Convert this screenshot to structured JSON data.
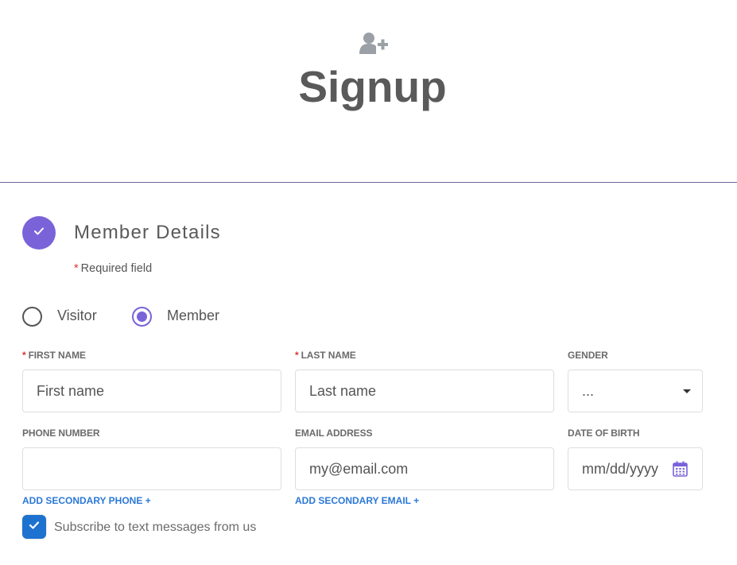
{
  "header": {
    "icon": "add-user-icon",
    "title": "Signup"
  },
  "section": {
    "step_icon": "check-icon",
    "title": "Member Details",
    "required_star": "*",
    "required_note": "Required field"
  },
  "member_type": {
    "options": [
      {
        "label": "Visitor",
        "selected": false
      },
      {
        "label": "Member",
        "selected": true
      }
    ]
  },
  "fields": {
    "first_name": {
      "label": "FIRST NAME",
      "required": "*",
      "placeholder": "First name",
      "value": ""
    },
    "last_name": {
      "label": "LAST NAME",
      "required": "*",
      "placeholder": "Last name",
      "value": ""
    },
    "gender": {
      "label": "GENDER",
      "selected": "...",
      "icon": "caret-down-icon"
    },
    "phone": {
      "label": "PHONE NUMBER",
      "value": ""
    },
    "email": {
      "label": "EMAIL ADDRESS",
      "placeholder": "my@email.com",
      "value": ""
    },
    "dob": {
      "label": "DATE OF BIRTH",
      "placeholder": "mm/dd/yyyy",
      "icon": "calendar-icon"
    }
  },
  "links": {
    "secondary_phone": "ADD SECONDARY PHONE +",
    "secondary_email": "ADD SECONDARY EMAIL +"
  },
  "subscribe": {
    "checked": true,
    "label": "Subscribe to text messages from us"
  },
  "colors": {
    "accent": "#7a63d9",
    "link": "#2b78d6",
    "checkbox": "#1d72cf",
    "required": "#d9352b"
  }
}
